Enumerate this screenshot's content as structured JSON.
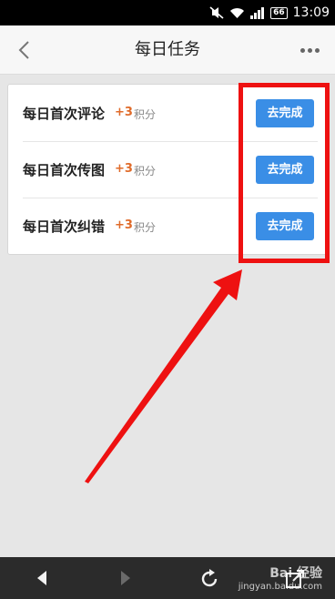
{
  "status_bar": {
    "time": "13:09",
    "battery": "66",
    "icons": [
      "mute-icon",
      "wifi-icon",
      "signal-icon",
      "battery-icon"
    ]
  },
  "header": {
    "title": "每日任务",
    "back_icon": "chevron-left-icon",
    "more_icon": "more-dots-icon"
  },
  "tasks": [
    {
      "name": "每日首次评论",
      "points": "+3",
      "unit": "积分",
      "button": "去完成"
    },
    {
      "name": "每日首次传图",
      "points": "+3",
      "unit": "积分",
      "button": "去完成"
    },
    {
      "name": "每日首次纠错",
      "points": "+3",
      "unit": "积分",
      "button": "去完成"
    }
  ],
  "bottom_bar": {
    "icons": [
      "back-triangle-icon",
      "forward-triangle-icon",
      "refresh-icon",
      "share-icon"
    ]
  },
  "watermark": {
    "top": "Bai 经验",
    "bottom": "jingyan.baidu.com"
  },
  "colors": {
    "accent_button": "#3a8ee6",
    "points": "#e06b2a",
    "annotation": "#ee1111"
  }
}
